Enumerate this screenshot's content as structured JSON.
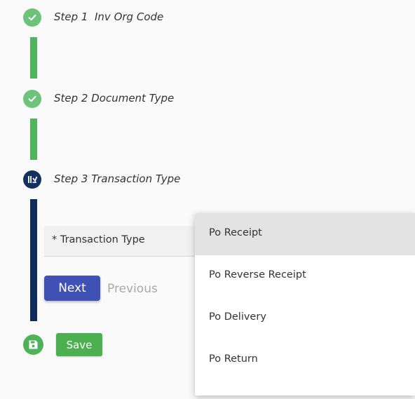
{
  "steps": [
    {
      "label": "Step 1  Inv Org Code",
      "status": "completed"
    },
    {
      "label": "Step 2 Document Type",
      "status": "completed"
    },
    {
      "label": "Step 3 Transaction Type",
      "status": "active"
    }
  ],
  "form": {
    "transaction_type_label": "* Transaction Type"
  },
  "buttons": {
    "next_label": "Next",
    "previous_label": "Previous",
    "save_label": "Save"
  },
  "dropdown": {
    "options": [
      "Po Receipt",
      "Po Reverse Receipt",
      "Po Delivery",
      "Po Return"
    ],
    "highlighted": "Po Receipt"
  },
  "icons": {
    "completed": "check-circle-icon",
    "active": "transaction-icon",
    "save": "floppy-disk-icon"
  },
  "colors": {
    "completed": "#52b35e",
    "active": "#0f2c5c",
    "primary_button": "#3f51b5",
    "save_button": "#4caf50"
  }
}
